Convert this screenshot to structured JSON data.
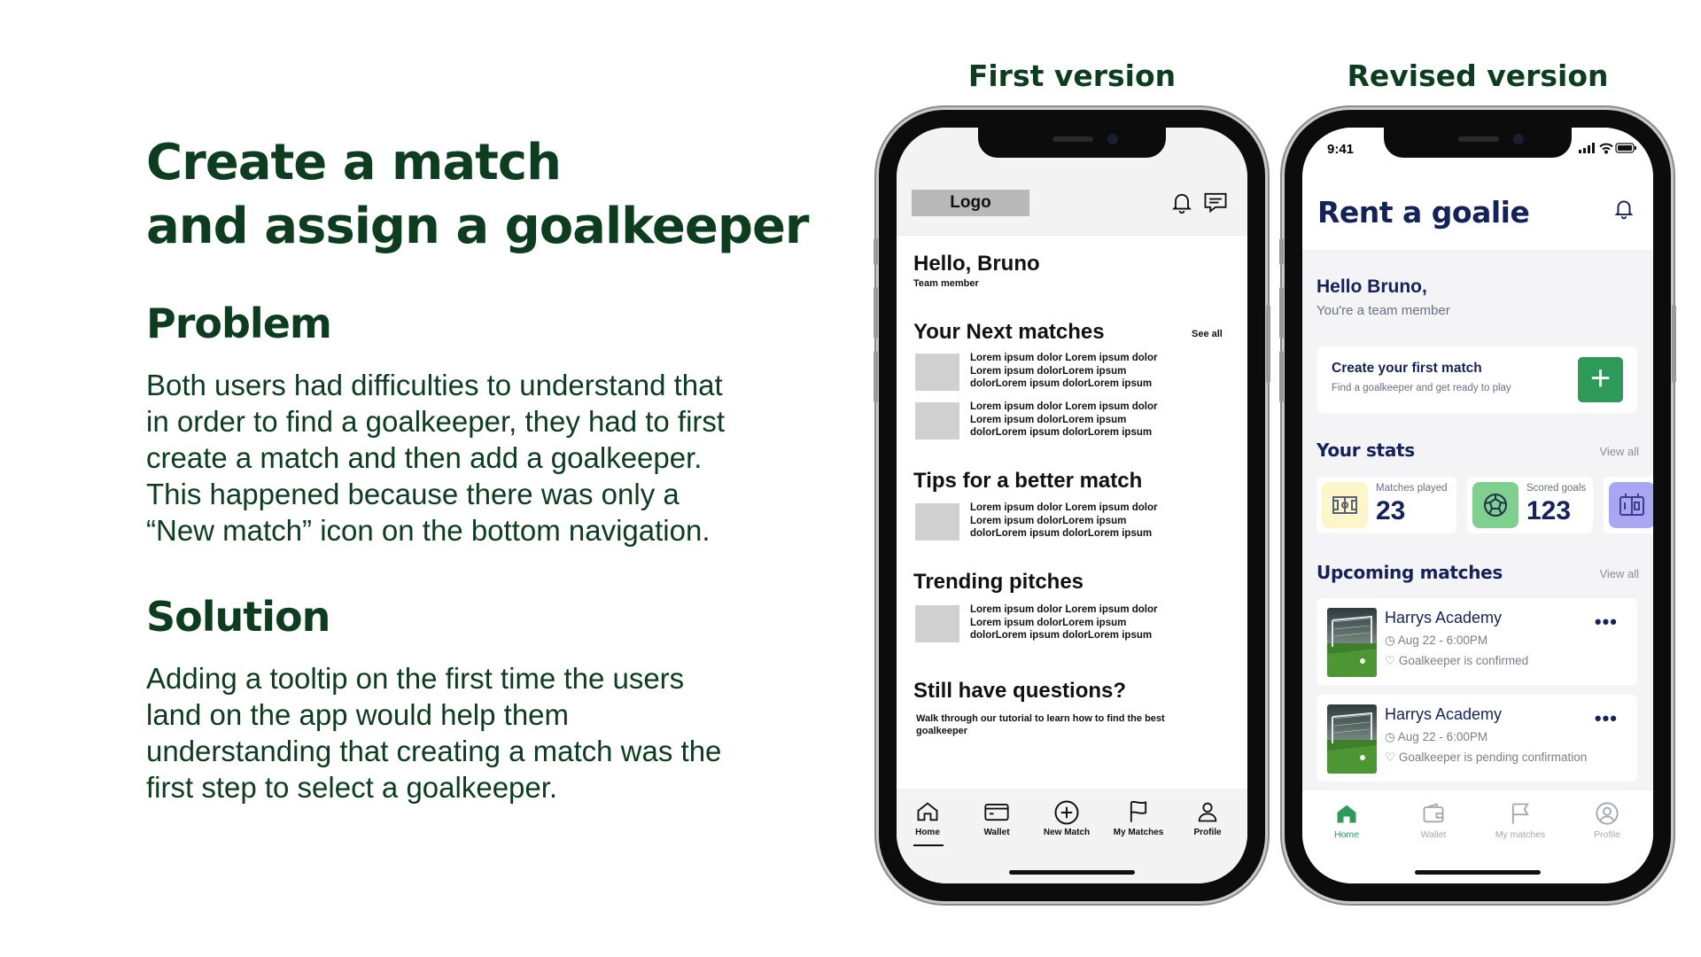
{
  "copy": {
    "headline_line1": "Create a match",
    "headline_line2": "and assign a goalkeeper",
    "problem_title": "Problem",
    "problem_lines": [
      "Both users had difficulties to understand that",
      "in order to find a goalkeeper, they had to first",
      "create a match and then add a goalkeeper.",
      "This happened because there was only a",
      "“New match” icon on the bottom navigation."
    ],
    "solution_title": "Solution",
    "solution_lines": [
      "Adding a tooltip on the first time the users",
      "land on the app would help them",
      "understanding that creating a match was the",
      "first step to select a goalkeeper."
    ]
  },
  "labels": {
    "first": "First version",
    "revised": "Revised version"
  },
  "first_version": {
    "logo": "Logo",
    "icons": [
      "bell-icon",
      "chat-icon"
    ],
    "greeting": "Hello, Bruno",
    "role": "Team member",
    "next_matches_title": "Your Next matches",
    "see_all": "See all",
    "placeholder_line1": "Lorem ipsum dolor Lorem ipsum dolor",
    "placeholder_line2": "Lorem ipsum dolorLorem ipsum",
    "placeholder_line3": "dolorLorem ipsum dolorLorem ipsum",
    "tips_title": "Tips for a better match",
    "trending_title": "Trending pitches",
    "questions_title": "Still have questions?",
    "questions_text": "Walk through our tutorial to learn how to find the best goalkeeper",
    "nav": [
      {
        "label": "Home",
        "icon": "home-icon"
      },
      {
        "label": "Wallet",
        "icon": "wallet-icon"
      },
      {
        "label": "New Match",
        "icon": "plus-circle-icon"
      },
      {
        "label": "My Matches",
        "icon": "flag-icon"
      },
      {
        "label": "Profile",
        "icon": "user-icon"
      }
    ]
  },
  "revised_version": {
    "time": "9:41",
    "title": "Rent a goalie",
    "greeting": "Hello Bruno,",
    "role": "You're a team member",
    "create_title": "Create your first match",
    "create_sub": "Find a goalkeeper and get ready to play",
    "stats_title": "Your stats",
    "view_all": "View all",
    "stats": [
      {
        "label": "Matches played",
        "value": "23",
        "icon": "pitch-icon",
        "color": "#fdf6c8"
      },
      {
        "label": "Scored goals",
        "value": "123",
        "icon": "ball-icon",
        "color": "#7fd08f"
      },
      {
        "label": "",
        "value": "",
        "icon": "scoreboard-icon",
        "color": "#a9a6f2"
      }
    ],
    "upcoming_title": "Upcoming matches",
    "matches": [
      {
        "name": "Harrys Academy",
        "date": "Aug 22 - 6:00PM",
        "status": "Goalkeeper is confirmed"
      },
      {
        "name": "Harrys Academy",
        "date": "Aug 22 - 6:00PM",
        "status": "Goalkeeper is pending confirmation"
      }
    ],
    "nav": [
      {
        "label": "Home",
        "icon": "home-icon"
      },
      {
        "label": "Wallet",
        "icon": "wallet-icon"
      },
      {
        "label": "My matches",
        "icon": "flag-icon"
      },
      {
        "label": "Profile",
        "icon": "user-icon"
      }
    ],
    "accent": "#2d9a5a"
  }
}
